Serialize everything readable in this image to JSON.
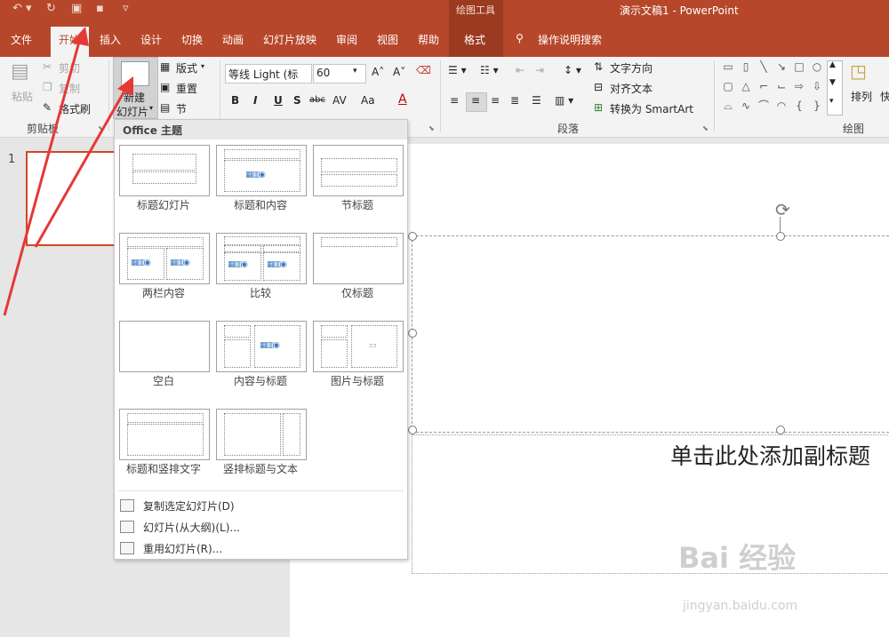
{
  "window": {
    "title": "演示文稿1  -  PowerPoint",
    "contextual_group": "绘图工具"
  },
  "tabs": [
    "文件",
    "开始",
    "插入",
    "设计",
    "切换",
    "动画",
    "幻灯片放映",
    "审阅",
    "视图",
    "帮助",
    "格式"
  ],
  "tell_me": "操作说明搜索",
  "ribbon": {
    "clipboard": {
      "paste": "粘贴",
      "cut": "剪切",
      "copy": "复制",
      "format_painter": "格式刷",
      "group_label": "剪贴板"
    },
    "slides": {
      "new_slide_line1": "新建",
      "new_slide_line2": "幻灯片",
      "layout": "版式",
      "reset": "重置",
      "section": "节"
    },
    "font": {
      "name": "等线 Light (标",
      "size": "60",
      "bold": "B",
      "italic": "I",
      "underline": "U",
      "shadow": "S",
      "strike": "abc",
      "spacing": "AV",
      "case": "Aa",
      "color": "A"
    },
    "paragraph": {
      "text_direction": "文字方向",
      "align_text": "对齐文本",
      "smartart": "转换为 SmartArt",
      "group_label": "段落"
    },
    "drawing": {
      "arrange": "排列",
      "quick_styles": "快",
      "group_label": "绘图"
    }
  },
  "thumbnail": {
    "number": "1"
  },
  "slide": {
    "subtitle_placeholder": "单击此处添加副标题"
  },
  "dropdown": {
    "header": "Office 主题",
    "layouts": [
      "标题幻灯片",
      "标题和内容",
      "节标题",
      "两栏内容",
      "比较",
      "仅标题",
      "空白",
      "内容与标题",
      "图片与标题",
      "标题和竖排文字",
      "竖排标题与文本"
    ],
    "actions": [
      "复制选定幻灯片(D)",
      "幻灯片(从大纲)(L)...",
      "重用幻灯片(R)..."
    ]
  },
  "watermark": {
    "brand": "Bai  经验",
    "url": "jingyan.baidu.com"
  },
  "colors": {
    "accent": "#b7472a",
    "selection": "#d24726"
  }
}
